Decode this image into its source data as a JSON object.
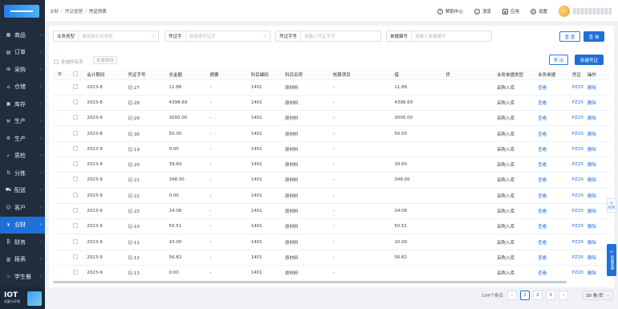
{
  "sidebar": {
    "items": [
      {
        "label": "商品",
        "icon": "grid-icon"
      },
      {
        "label": "订单",
        "icon": "order-icon"
      },
      {
        "label": "采购",
        "icon": "cart-icon"
      },
      {
        "label": "仓储",
        "icon": "warehouse-icon"
      },
      {
        "label": "库存",
        "icon": "box-icon"
      },
      {
        "label": "生产",
        "icon": "factory-icon"
      },
      {
        "label": "生产",
        "icon": "production-icon"
      },
      {
        "label": "质检",
        "icon": "check-icon"
      },
      {
        "label": "分拣",
        "icon": "sort-icon"
      },
      {
        "label": "配送",
        "icon": "truck-icon"
      },
      {
        "label": "客户",
        "icon": "user-icon"
      },
      {
        "label": "业财",
        "icon": "finance-icon"
      },
      {
        "label": "财务",
        "icon": "money-icon"
      },
      {
        "label": "报表",
        "icon": "report-icon"
      },
      {
        "label": "学生餐",
        "icon": "meal-icon"
      }
    ],
    "active_index": 11,
    "footer_title": "IOT",
    "footer_sub": "设备与环境"
  },
  "header": {
    "breadcrumb": [
      "业财",
      "凭证管理",
      "凭证列表"
    ],
    "links": [
      {
        "label": "帮助中心",
        "icon": "help-icon"
      },
      {
        "label": "消息",
        "icon": "bell-icon"
      },
      {
        "label": "应用",
        "icon": "app-icon"
      },
      {
        "label": "设置",
        "icon": "gear-icon"
      }
    ]
  },
  "filters": {
    "business_type": {
      "label": "业务类型",
      "placeholder": "请选择业务类型"
    },
    "voucher_word": {
      "label": "凭证字",
      "placeholder": "请选择凭证字"
    },
    "voucher_no": {
      "label": "凭证字号",
      "placeholder": "请输入凭证字号"
    },
    "doc_no": {
      "label": "单据编号",
      "placeholder": "请输入单据编号"
    },
    "reset_label": "重 置",
    "search_label": "查 询"
  },
  "toolbar": {
    "select_all_label": "全选所有页",
    "batch_delete_label": "批量删除",
    "export_label": "导 出",
    "new_label": "新建凭证"
  },
  "table": {
    "columns": [
      "",
      "会计期间",
      "凭证字号",
      "总金额",
      "摘要",
      "科目编码",
      "科目名称",
      "核算项目",
      "借",
      "贷",
      "业务单据类型",
      "业务单据",
      "凭证",
      "操作"
    ],
    "rows": [
      {
        "period": "2023-8",
        "voucher": "记-27",
        "total": "11.88",
        "summary": "-",
        "code": "1401",
        "subject": "原材料",
        "item": "-",
        "debit": "11.88",
        "credit": "",
        "doc_type": "采购入库",
        "doc": "查看",
        "pz": "PZ20",
        "op": "删除"
      },
      {
        "period": "2023-8",
        "voucher": "记-28",
        "total": "4398.69",
        "summary": "-",
        "code": "1401",
        "subject": "原材料",
        "item": "-",
        "debit": "4398.69",
        "credit": "",
        "doc_type": "采购入库",
        "doc": "查看",
        "pz": "PZ20",
        "op": "删除"
      },
      {
        "period": "2023-9",
        "voucher": "记-29",
        "total": "3000.00",
        "summary": "-",
        "code": "1401",
        "subject": "原材料",
        "item": "-",
        "debit": "3000.00",
        "credit": "",
        "doc_type": "采购入库",
        "doc": "查看",
        "pz": "PZ20",
        "op": "删除"
      },
      {
        "period": "2023-8",
        "voucher": "记-30",
        "total": "50.00",
        "summary": "-",
        "code": "1401",
        "subject": "原材料",
        "item": "-",
        "debit": "50.00",
        "credit": "",
        "doc_type": "采购入库",
        "doc": "查看",
        "pz": "PZ20",
        "op": "删除"
      },
      {
        "period": "2023-9",
        "voucher": "记-19",
        "total": "0.00",
        "summary": "-",
        "code": "1401",
        "subject": "原材料",
        "item": "-",
        "debit": "",
        "credit": "",
        "doc_type": "采购入库",
        "doc": "查看",
        "pz": "PZ20",
        "op": "删除"
      },
      {
        "period": "2023-9",
        "voucher": "记-20",
        "total": "39.60",
        "summary": "-",
        "code": "1401",
        "subject": "原材料",
        "item": "-",
        "debit": "39.60",
        "credit": "",
        "doc_type": "采购入库",
        "doc": "查看",
        "pz": "PZ20",
        "op": "删除"
      },
      {
        "period": "2023-9",
        "voucher": "记-21",
        "total": "348.00",
        "summary": "-",
        "code": "1401",
        "subject": "原材料",
        "item": "-",
        "debit": "348.00",
        "credit": "",
        "doc_type": "采购入库",
        "doc": "查看",
        "pz": "PZ20",
        "op": "删除"
      },
      {
        "period": "2023-9",
        "voucher": "记-22",
        "total": "0.00",
        "summary": "-",
        "code": "1401",
        "subject": "原材料",
        "item": "-",
        "debit": "",
        "credit": "",
        "doc_type": "采购入库",
        "doc": "查看",
        "pz": "PZ20",
        "op": "删除"
      },
      {
        "period": "2023-9",
        "voucher": "记-23",
        "total": "24.08",
        "summary": "-",
        "code": "1401",
        "subject": "原材料",
        "item": "-",
        "debit": "24.08",
        "credit": "",
        "doc_type": "采购入库",
        "doc": "查看",
        "pz": "PZ20",
        "op": "删除"
      },
      {
        "period": "2023-9",
        "voucher": "记-10",
        "total": "50.51",
        "summary": "-",
        "code": "1401",
        "subject": "原材料",
        "item": "-",
        "debit": "50.51",
        "credit": "",
        "doc_type": "采购入库",
        "doc": "查看",
        "pz": "PZ20",
        "op": "删除"
      },
      {
        "period": "2023-9",
        "voucher": "记-11",
        "total": "10.00",
        "summary": "-",
        "code": "1401",
        "subject": "原材料",
        "item": "-",
        "debit": "10.00",
        "credit": "",
        "doc_type": "采购入库",
        "doc": "查看",
        "pz": "PZ20",
        "op": "删除"
      },
      {
        "period": "2023-9",
        "voucher": "记-12",
        "total": "56.82",
        "summary": "-",
        "code": "1401",
        "subject": "原材料",
        "item": "-",
        "debit": "56.82",
        "credit": "",
        "doc_type": "采购入库",
        "doc": "查看",
        "pz": "PZ20",
        "op": "删除"
      },
      {
        "period": "2023-9",
        "voucher": "记-13",
        "total": "0.00",
        "summary": "-",
        "code": "1401",
        "subject": "原材料",
        "item": "-",
        "debit": "",
        "credit": "",
        "doc_type": "采购入库",
        "doc": "查看",
        "pz": "PZ20",
        "op": "删除"
      }
    ]
  },
  "pagination": {
    "total_label": "104个条目",
    "pages": [
      "1",
      "2",
      "3"
    ],
    "current": "1",
    "page_size": "30 条/页"
  },
  "float": {
    "task_label": "任务",
    "service_label": "智能客服"
  },
  "colors": {
    "primary": "#1f6fd8",
    "sidebar_bg": "#1f2d3d"
  }
}
